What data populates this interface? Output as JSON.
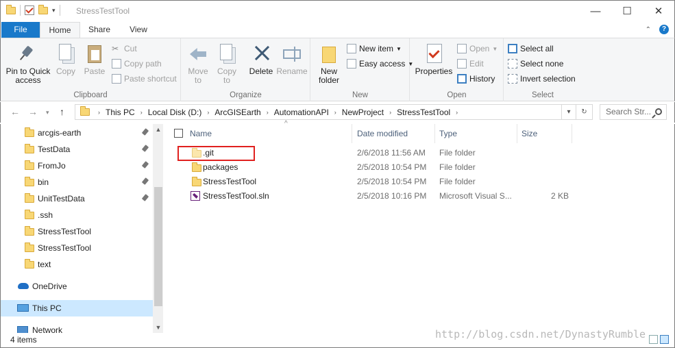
{
  "window": {
    "title": "StressTestTool",
    "minimize_glyph": "—",
    "maximize_glyph": "☐",
    "close_glyph": "✕"
  },
  "ribbon_tabs": {
    "file": "File",
    "home": "Home",
    "share": "Share",
    "view": "View"
  },
  "ribbon": {
    "clipboard": {
      "label": "Clipboard",
      "pin": "Pin to Quick access",
      "copy": "Copy",
      "paste": "Paste",
      "cut": "Cut",
      "copy_path": "Copy path",
      "paste_shortcut": "Paste shortcut"
    },
    "organize": {
      "label": "Organize",
      "move_to": "Move to",
      "copy_to": "Copy to",
      "delete": "Delete",
      "rename": "Rename"
    },
    "new": {
      "label": "New",
      "new_folder": "New folder",
      "new_item": "New item",
      "easy_access": "Easy access"
    },
    "open": {
      "label": "Open",
      "properties": "Properties",
      "open": "Open",
      "edit": "Edit",
      "history": "History"
    },
    "select": {
      "label": "Select",
      "select_all": "Select all",
      "select_none": "Select none",
      "invert_selection": "Invert selection"
    }
  },
  "address": {
    "crumbs": [
      "This PC",
      "Local Disk (D:)",
      "ArcGISEarth",
      "AutomationAPI",
      "NewProject",
      "StressTestTool"
    ],
    "search_placeholder": "Search Str..."
  },
  "nav_pane": {
    "items": [
      {
        "label": "arcgis-earth",
        "pinned": true
      },
      {
        "label": "TestData",
        "pinned": true
      },
      {
        "label": "FromJo",
        "pinned": true
      },
      {
        "label": "bin",
        "pinned": true
      },
      {
        "label": "UnitTestData",
        "pinned": true
      },
      {
        "label": ".ssh",
        "pinned": false
      },
      {
        "label": "StressTestTool",
        "pinned": false
      },
      {
        "label": "StressTestTool",
        "pinned": false
      },
      {
        "label": "text",
        "pinned": false
      }
    ],
    "onedrive": "OneDrive",
    "this_pc": "This PC",
    "network": "Network"
  },
  "file_list": {
    "columns": {
      "name": "Name",
      "date": "Date modified",
      "type": "Type",
      "size": "Size"
    },
    "rows": [
      {
        "name": ".git",
        "date": "2/6/2018 11:56 AM",
        "type": "File folder",
        "size": "",
        "icon": "folder-icon"
      },
      {
        "name": "packages",
        "date": "2/5/2018 10:54 PM",
        "type": "File folder",
        "size": "",
        "icon": "folder-icon"
      },
      {
        "name": "StressTestTool",
        "date": "2/5/2018 10:54 PM",
        "type": "File folder",
        "size": "",
        "icon": "folder-icon"
      },
      {
        "name": "StressTestTool.sln",
        "date": "2/5/2018 10:16 PM",
        "type": "Microsoft Visual S...",
        "size": "2 KB",
        "icon": "solution-file-icon"
      }
    ]
  },
  "status": {
    "item_count": "4 items",
    "watermark": "http://blog.csdn.net/DynastyRumble"
  },
  "colors": {
    "accent": "#1979ca",
    "selection": "#cce8ff",
    "highlight_box": "#e0201e",
    "folder": "#f8d775"
  }
}
